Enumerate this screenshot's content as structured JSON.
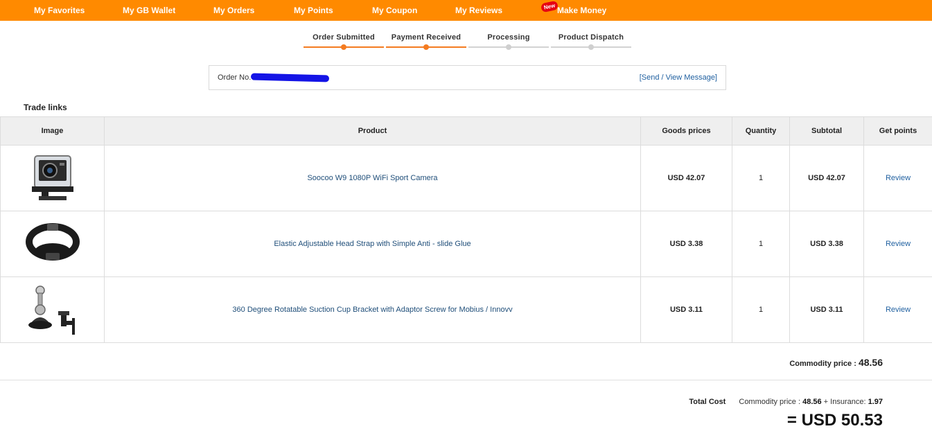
{
  "nav": {
    "items": [
      {
        "label": "My Favorites"
      },
      {
        "label": "My GB Wallet"
      },
      {
        "label": "My Orders"
      },
      {
        "label": "My Points"
      },
      {
        "label": "My Coupon"
      },
      {
        "label": "My Reviews"
      },
      {
        "label": "Make Money",
        "badge": "New"
      }
    ],
    "bar_color": "#ff8a00",
    "badge_color": "#e60012"
  },
  "steps": [
    {
      "label": "Order Submitted",
      "active": true
    },
    {
      "label": "Payment Received",
      "active": true
    },
    {
      "label": "Processing",
      "active": false
    },
    {
      "label": "Product Dispatch",
      "active": false
    }
  ],
  "order": {
    "label": "Order No.",
    "number_redacted": true,
    "message_link": "[Send / View Message]"
  },
  "section_title": "Trade links",
  "table": {
    "headers": [
      "Image",
      "Product",
      "Goods prices",
      "Quantity",
      "Subtotal",
      "Get points"
    ],
    "rows": [
      {
        "image_icon": "action-camera-icon",
        "product": "Soocoo W9 1080P WiFi Sport Camera",
        "price": "USD 42.07",
        "quantity": "1",
        "subtotal": "USD 42.07",
        "action": "Review"
      },
      {
        "image_icon": "head-strap-icon",
        "product": "Elastic Adjustable Head Strap with Simple Anti - slide Glue",
        "price": "USD 3.38",
        "quantity": "1",
        "subtotal": "USD 3.38",
        "action": "Review"
      },
      {
        "image_icon": "suction-cup-mount-icon",
        "product": "360 Degree Rotatable Suction Cup Bracket with Adaptor Screw for Mobius / Innovv",
        "price": "USD 3.11",
        "quantity": "1",
        "subtotal": "USD 3.11",
        "action": "Review"
      }
    ]
  },
  "totals": {
    "commodity_label": "Commodity price :",
    "commodity_value": "48.56",
    "total_cost_label": "Total Cost",
    "breakdown_commodity_label": "Commodity price :",
    "breakdown_commodity_value": "48.56",
    "breakdown_plus": "+ Insurance:",
    "insurance_value": "1.97",
    "grand_total": "= USD 50.53"
  },
  "colors": {
    "accent": "#f47b20",
    "link": "#2060a0",
    "redaction": "#1414e6"
  }
}
